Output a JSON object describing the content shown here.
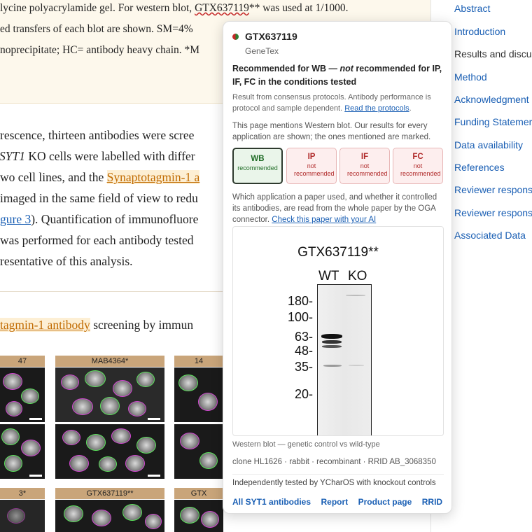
{
  "article": {
    "caption_lines": [
      {
        "before": "lycine polyacrylamide gel. For western blot, ",
        "antibody": "GTX637119",
        "after": "** was used at 1/1000."
      },
      {
        "text": "ed transfers of each blot are shown. SM=4%"
      },
      {
        "text": "noprecipitate; HC= antibody heavy chain. *M"
      }
    ],
    "body": {
      "l1": "rescence, thirteen antibodies were scree",
      "l2_em": "SYT1",
      "l2_rest": " KO cells were labelled with differ",
      "l3_before": "wo cell lines, and the ",
      "l3_link": "Synaptotagmin-1 a",
      "l4": " imaged in the same field of view to redu",
      "l5_link": "gure 3",
      "l5_rest": "). Quantification of immunofluore",
      "l6": " was performed for each antibody tested",
      "l7": "resentative of this analysis."
    },
    "figure_title": {
      "link": "tagmin-1 antibody",
      "rest": " screening by immun"
    },
    "tile_labels": {
      "r1c1": "47",
      "r1c2": "MAB4364*",
      "r1c3": "14",
      "r2c1": "3*",
      "r2c2": "GTX637119**",
      "r2c3": "GTX"
    }
  },
  "toc": {
    "items": [
      "Abstract",
      "Introduction",
      "Results and discus",
      "Method",
      "Acknowledgment",
      "Funding Statemer",
      "Data availability",
      "References",
      "Reviewer respons",
      "Reviewer respons",
      "Associated Data"
    ],
    "current_index": 2
  },
  "popover": {
    "name": "GTX637119",
    "vendor": "GeneTex",
    "rec_part1": "Recommended for WB — ",
    "rec_not": "not",
    "rec_part2": " recommended for IP, IF, FC in the conditions tested",
    "consensus_text": "Result from consensus protocols. Antibody performance is protocol and sample dependent. ",
    "consensus_link": "Read the protocols",
    "consensus_end": ".",
    "mention_text": "This page mentions Western blot. Our results for every application are shown; the ones mentioned are marked.",
    "apps": [
      {
        "code": "WB",
        "status": "recommended"
      },
      {
        "code": "IP",
        "status": "not recommended"
      },
      {
        "code": "IF",
        "status": "not recommended"
      },
      {
        "code": "FC",
        "status": "not recommended"
      }
    ],
    "paper_text": "Which application a paper used, and whether it controlled its antibodies, are read from the whole paper by the OGA connector. ",
    "paper_link": "Check this paper with your AI",
    "blot": {
      "title": "GTX637119**",
      "lanes": [
        "WT",
        "KO"
      ],
      "markers": [
        "180-",
        "100-",
        "63-",
        "48-",
        "35-",
        "20-"
      ]
    },
    "blot_caption": "Western blot — genetic control vs wild-type",
    "meta": "clone HL1626 · rabbit · recombinant · RRID AB_3068350",
    "independent": "Independently tested by YCharOS with knockout controls",
    "links": [
      "All SYT1 antibodies",
      "Report",
      "Product page",
      "RRID"
    ],
    "colors": {
      "recommended": "#1e6b25",
      "not_recommended": "#b02a2a",
      "link": "#1a5fb4"
    }
  }
}
